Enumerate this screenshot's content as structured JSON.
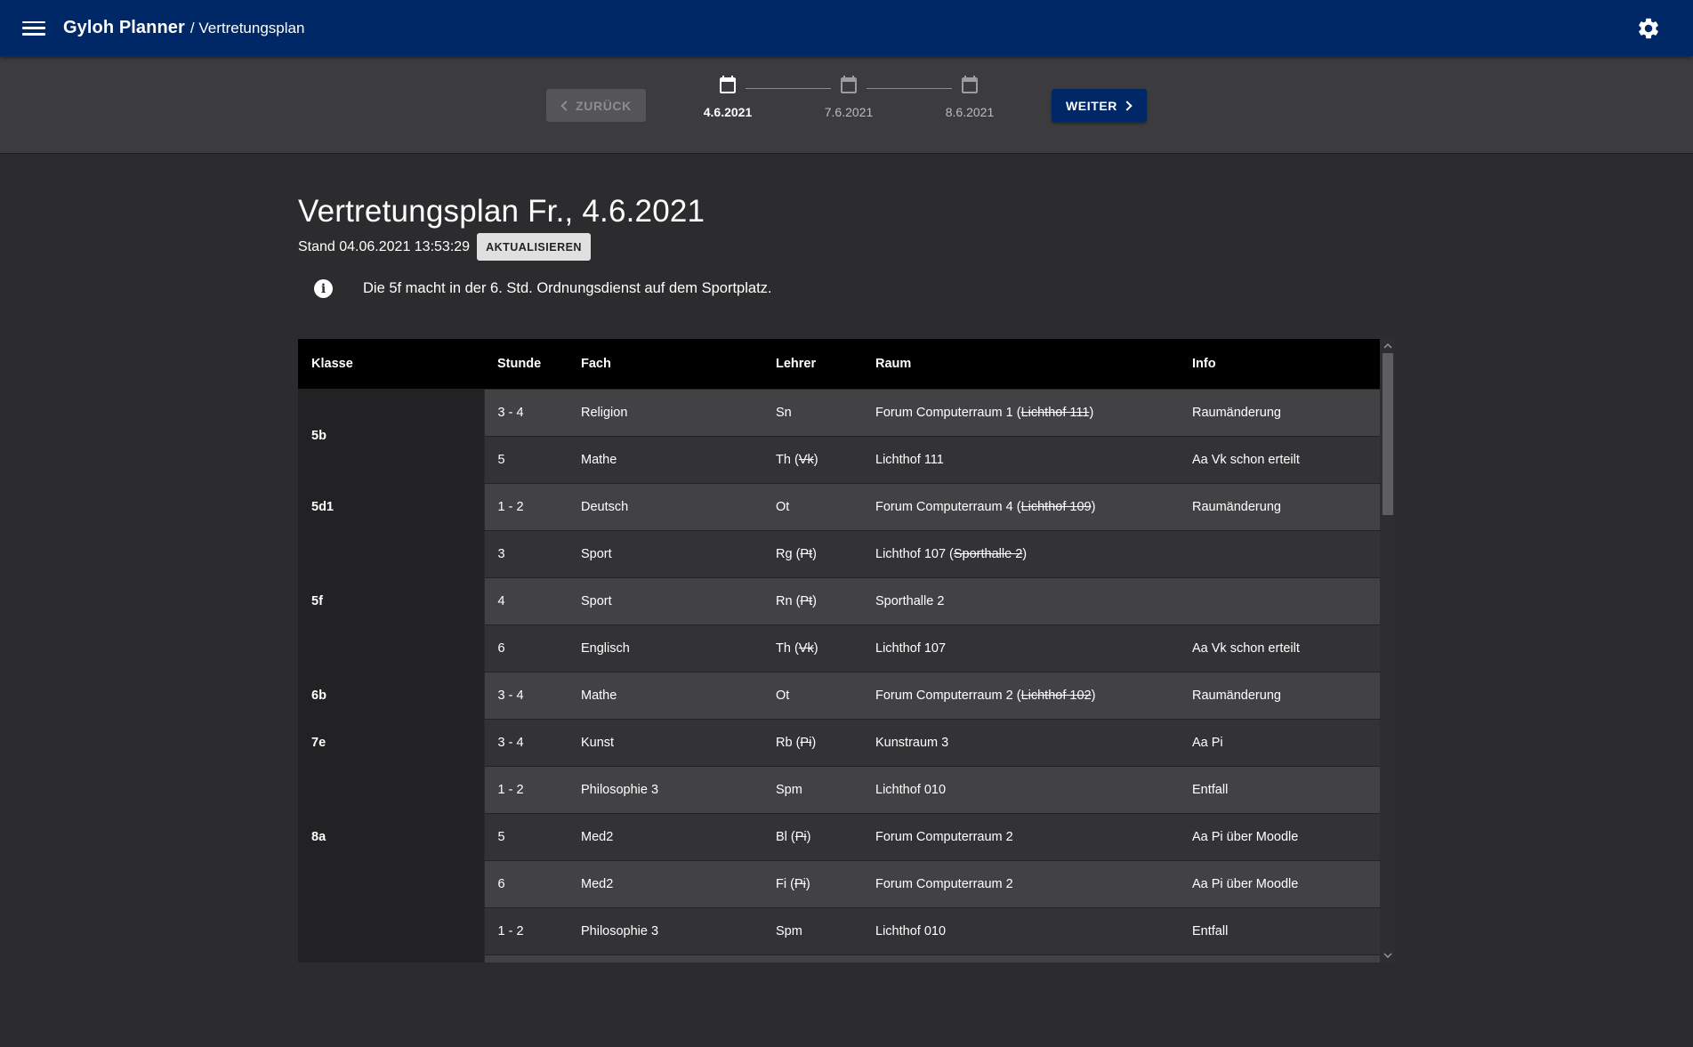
{
  "appbar": {
    "title": "Gyloh Planner",
    "subtitle": "/ Vertretungsplan",
    "menu_icon": "menu-icon",
    "settings_icon": "settings-icon"
  },
  "stepper": {
    "back_label": "ZURÜCK",
    "next_label": "WEITER",
    "dates": [
      {
        "label": "4.6.2021",
        "active": true
      },
      {
        "label": "7.6.2021",
        "active": false
      },
      {
        "label": "8.6.2021",
        "active": false
      }
    ]
  },
  "main": {
    "title": "Vertretungsplan Fr., 4.6.2021",
    "stand": "Stand 04.06.2021 13:53:29",
    "refresh_label": "AKTUALISIEREN",
    "info_message": "Die 5f macht in der 6. Std. Ordnungsdienst auf dem Sportplatz."
  },
  "table": {
    "headers": [
      "Klasse",
      "Stunde",
      "Fach",
      "Lehrer",
      "Raum",
      "Info"
    ],
    "groups": [
      {
        "klasse": "5b",
        "rows": [
          {
            "stunde": "3 - 4",
            "fach": "Religion",
            "lehrer": "Sn",
            "lehrer_old": "",
            "raum": "Forum Computerraum 1",
            "raum_old": "Lichthof 111",
            "info": "Raumänderung"
          },
          {
            "stunde": "5",
            "fach": "Mathe",
            "lehrer": "Th",
            "lehrer_old": "Vk",
            "raum": "Lichthof 111",
            "raum_old": "",
            "info": "Aa Vk schon erteilt"
          }
        ]
      },
      {
        "klasse": "5d1",
        "rows": [
          {
            "stunde": "1 - 2",
            "fach": "Deutsch",
            "lehrer": "Ot",
            "lehrer_old": "",
            "raum": "Forum Computerraum 4",
            "raum_old": "Lichthof 109",
            "info": "Raumänderung"
          }
        ]
      },
      {
        "klasse": "5f",
        "rows": [
          {
            "stunde": "3",
            "fach": "Sport",
            "lehrer": "Rg",
            "lehrer_old": "Pt",
            "raum": "Lichthof 107",
            "raum_old": "Sporthalle 2",
            "info": ""
          },
          {
            "stunde": "4",
            "fach": "Sport",
            "lehrer": "Rn",
            "lehrer_old": "Pt",
            "raum": "Sporthalle 2",
            "raum_old": "",
            "info": ""
          },
          {
            "stunde": "6",
            "fach": "Englisch",
            "lehrer": "Th",
            "lehrer_old": "Vk",
            "raum": "Lichthof 107",
            "raum_old": "",
            "info": "Aa Vk schon erteilt"
          }
        ]
      },
      {
        "klasse": "6b",
        "rows": [
          {
            "stunde": "3 - 4",
            "fach": "Mathe",
            "lehrer": "Ot",
            "lehrer_old": "",
            "raum": "Forum Computerraum 2",
            "raum_old": "Lichthof 102",
            "info": "Raumänderung"
          }
        ]
      },
      {
        "klasse": "7e",
        "rows": [
          {
            "stunde": "3 - 4",
            "fach": "Kunst",
            "lehrer": "Rb",
            "lehrer_old": "Pi",
            "raum": "Kunstraum 3",
            "raum_old": "",
            "info": "Aa Pi"
          }
        ]
      },
      {
        "klasse": "8a",
        "rows": [
          {
            "stunde": "1 - 2",
            "fach": "Philosophie 3",
            "lehrer": "Spm",
            "lehrer_old": "",
            "raum": "Lichthof 010",
            "raum_old": "",
            "info": "Entfall"
          },
          {
            "stunde": "5",
            "fach": "Med2",
            "lehrer": "Bl",
            "lehrer_old": "Pi",
            "raum": "Forum Computerraum 2",
            "raum_old": "",
            "info": "Aa Pi über Moodle"
          },
          {
            "stunde": "6",
            "fach": "Med2",
            "lehrer": "Fi",
            "lehrer_old": "Pi",
            "raum": "Forum Computerraum 2",
            "raum_old": "",
            "info": "Aa Pi über Moodle"
          }
        ]
      },
      {
        "klasse": "",
        "rows": [
          {
            "stunde": "1 - 2",
            "fach": "Philosophie 3",
            "lehrer": "Spm",
            "lehrer_old": "",
            "raum": "Lichthof 010",
            "raum_old": "",
            "info": "Entfall"
          },
          {
            "stunde": "",
            "fach": "",
            "lehrer": "",
            "lehrer_old": "",
            "raum": "",
            "raum_old": "",
            "info": ""
          }
        ]
      }
    ]
  },
  "colors": {
    "appbar": "#002766",
    "background": "#2c2c2e",
    "stepbar": "#3c3c3f",
    "header_row": "#000000",
    "row_light": "#424245",
    "row_dark": "#333336"
  }
}
